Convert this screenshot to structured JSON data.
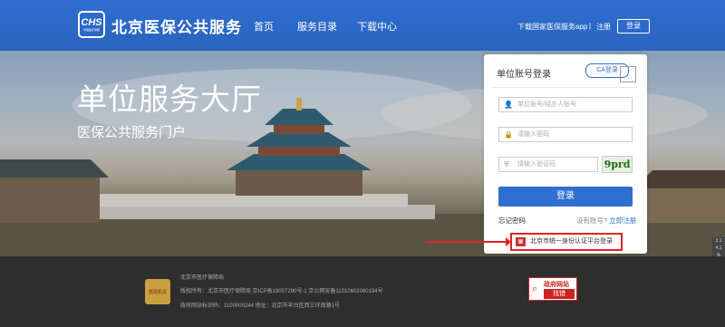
{
  "header": {
    "logo_text": "CHS",
    "logo_sub": "中国医疗保障",
    "site_title": "北京医保公共服务",
    "nav": [
      "首页",
      "服务目录",
      "下载中心"
    ],
    "download_app": "下载国家医保服务app",
    "separator": "|",
    "register": "注册",
    "login": "登录"
  },
  "hero": {
    "title": "单位服务大厅",
    "subtitle": "医保公共服务门户"
  },
  "login_panel": {
    "title": "单位账号登录",
    "ca_login": "CA登录",
    "account_placeholder": "单位账号/经办人账号",
    "password_placeholder": "请输入密码",
    "captcha_placeholder": "请输入验证码",
    "captcha_text": "9prd",
    "submit": "登录",
    "forgot_password": "忘记密码",
    "no_account": "没有账号?",
    "register_now": "立即注册",
    "unified_login": "北京市统一身份认证平台登录"
  },
  "side_tools": [
    "3.1",
    "4.1",
    "%"
  ],
  "footer": {
    "line1": "北京市医疗保障局",
    "line2": "版权所有：北京市医疗保障局  京ICP备19007290号-1  京公网安备11010602060194号",
    "line3": "政府网站标识码：1100000244     地址：北京市丰台区西三环南路1号",
    "gov_badge_top": "政府网站",
    "gov_badge_bottom": "找错",
    "emblem_text": "党政机关"
  },
  "colors": {
    "primary": "#2f6fd0",
    "highlight": "#e02424",
    "footer_bg": "#2e2e2e"
  },
  "icons": {
    "user": "user-icon",
    "lock": "lock-icon",
    "shield": "shield-icon",
    "qr": "qr-code-icon"
  }
}
